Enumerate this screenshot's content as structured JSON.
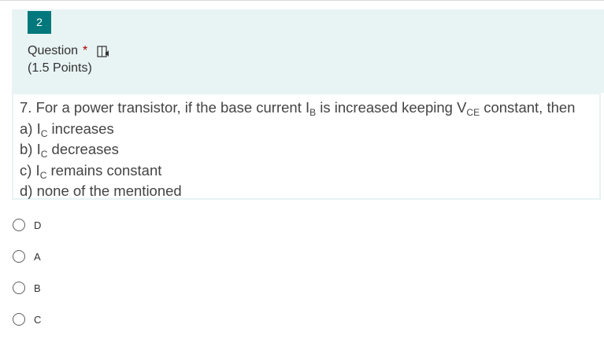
{
  "question": {
    "number": "2",
    "title": "Question",
    "required_marker": "*",
    "points": "(1.5 Points)",
    "reader_icon": "immersive-reader-icon"
  },
  "content": {
    "stem_prefix": "7. For a power transistor, if the base current I",
    "stem_sub1": "B",
    "stem_mid": " is increased keeping V",
    "stem_sub2": "CE",
    "stem_suffix": " constant, then",
    "a_prefix": "a) I",
    "a_sub": "C",
    "a_text": " increases",
    "b_prefix": "b) I",
    "b_sub": "C",
    "b_text": " decreases",
    "c_prefix": "c) I",
    "c_sub": "C",
    "c_text": " remains constant",
    "d_text": "d) none of the mentioned"
  },
  "options": [
    {
      "label": "D"
    },
    {
      "label": "A"
    },
    {
      "label": "B"
    },
    {
      "label": "C"
    }
  ],
  "colors": {
    "accent": "#03787c",
    "header_bg": "#e8f3f4",
    "required": "#a80000"
  }
}
